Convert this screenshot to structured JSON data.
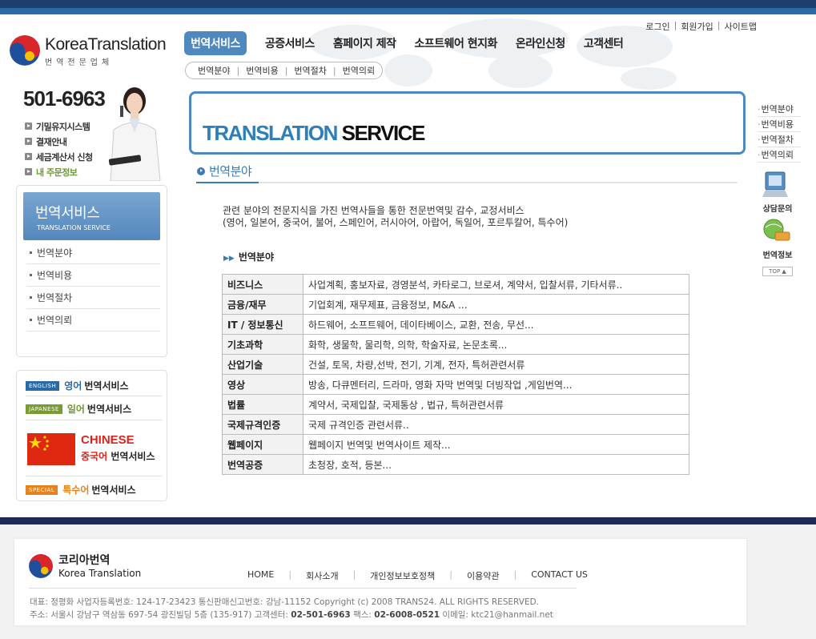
{
  "brand": {
    "name": "KoreaTranslation",
    "sub": "번역전문업체"
  },
  "util": {
    "links": [
      "로그인",
      "회원가입",
      "사이트맵"
    ]
  },
  "gnb": {
    "items": [
      "번역서비스",
      "공증서비스",
      "홈페이지 제작",
      "소프트웨어 현지화",
      "온라인신청",
      "고객센터"
    ]
  },
  "lnb": {
    "items": [
      "번역분야",
      "번역비용",
      "번역절차",
      "번역의뢰"
    ]
  },
  "left": {
    "phone": "501-6963",
    "quick": [
      "기밀유지시스템",
      "결재안내",
      "세금계산서 신청",
      "내 주문정보"
    ],
    "menu_title": "번역서비스",
    "menu_sub": "TRANSLATION SERVICE",
    "menu_items": [
      "번역분야",
      "번역비용",
      "번역절차",
      "번역의뢰"
    ],
    "langs": {
      "english_tag": "ENGLISH",
      "english_colored": "영어",
      "english_label": "번역서비스",
      "japanese_tag": "JAPANESE",
      "japanese_colored": "일어",
      "japanese_label": "번역서비스",
      "chinese_title": "CHINESE",
      "chinese_colored": "중국어",
      "chinese_label": "번역서비스",
      "special_tag": "SPECIAL",
      "special_colored": "특수어",
      "special_label": "번역서비스"
    }
  },
  "content": {
    "title_a": "TRANSLATION",
    "title_b": "SERVICE",
    "section_title": "번역분야",
    "intro_line1": "관련 분야의 전문지식을 가진 번역사들을 통한 전문번역및 감수, 교정서비스",
    "intro_line2": "(영어, 일본어, 중국어, 불어, 스페인어, 러시아어, 아랍어, 독일어, 포르투칼어, 특수어)",
    "sub_heading": "번역분야",
    "rows": [
      {
        "key": "비즈니스",
        "val": "사업계획, 홍보자료, 경영분석, 카타로그, 브로셔, 계약서, 입찰서류, 기타서류.."
      },
      {
        "key": "금융/재무",
        "val": "기업회계, 재무제표, 금융정보, M&A ..."
      },
      {
        "key": "IT / 정보통신",
        "val": "하드웨어, 소프트웨어, 데이타베이스, 교환, 전송, 무선..."
      },
      {
        "key": "기초과학",
        "val": "화학, 생물학, 물리학, 의학, 학술자료, 논문초록..."
      },
      {
        "key": "산업기술",
        "val": "건설, 토목, 차량,선박, 전기, 기계, 전자, 특허관련서류"
      },
      {
        "key": "영상",
        "val": "방송, 다큐멘터리, 드라마, 영화 자막 번역및 더빙작업 ,게임번역..."
      },
      {
        "key": "법률",
        "val": "계약서, 국제입찰, 국제통상 , 법규, 특허관련서류"
      },
      {
        "key": "국제규격인증",
        "val": "국제 규격인증 관련서류.."
      },
      {
        "key": "웹페이지",
        "val": "웹페이지 번역및 번역사이트 제작..."
      },
      {
        "key": "번역공증",
        "val": "초청장, 호적, 등본..."
      }
    ]
  },
  "right": {
    "nav": [
      "번역분야",
      "번역비용",
      "번역절차",
      "번역의뢰"
    ],
    "consult": "상담문의",
    "info": "번역정보",
    "top": "TOP"
  },
  "footer": {
    "logo_ko": "코리아번역",
    "logo_en": "Korea Translation",
    "nav": [
      "HOME",
      "회사소개",
      "개인정보보호정책",
      "이용약관",
      "CONTACT US"
    ],
    "line1": "대표: 정평화  사업자등록번호: 124-17-23423  통신판매신고번호: 강남-11152  Copyright (c) 2008 TRANS24.  ALL RIGHTS RESERVED.",
    "line2_a": "주소: 서울시 강남구 역삼동 697-54 광진빌딩 5층 (135-917)  고객센터:",
    "line2_phone": "02-501-6963",
    "line2_fax_label": "팩스:",
    "line2_fax": "02-6008-0521",
    "line2_email": "이메일: ktc21@hanmail.net"
  },
  "colors": {
    "accent": "#4f88bf",
    "navy": "#1e3e6e",
    "red": "#d9231c",
    "green": "#6b9b2e",
    "orange": "#e8821e"
  }
}
